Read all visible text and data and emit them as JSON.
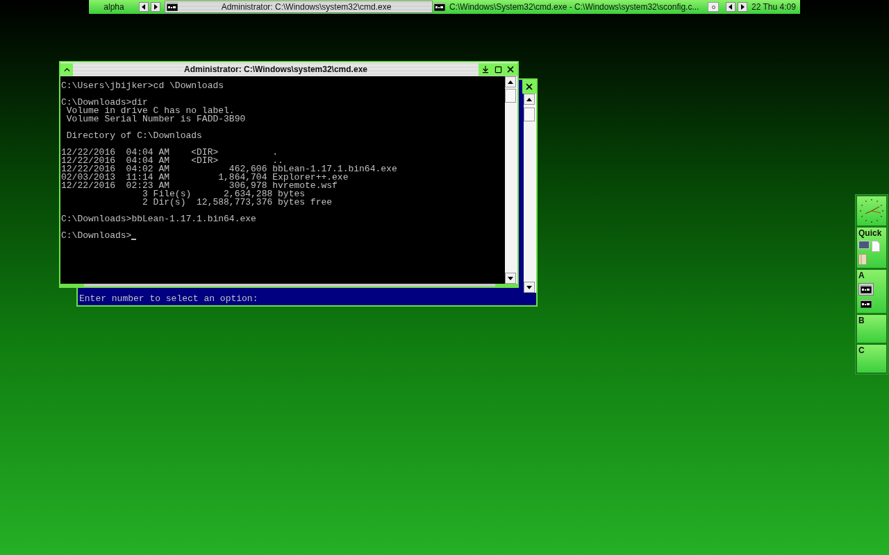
{
  "taskbar": {
    "workspace": "alpha",
    "tasks": [
      {
        "title": "Administrator: C:\\Windows\\system32\\cmd.exe",
        "selected": true
      },
      {
        "title": "C:\\Windows\\System32\\cmd.exe - C:\\Windows\\system32\\sconfig.c...",
        "selected": false
      }
    ],
    "clock": "22 Thu 4:09"
  },
  "back_window": {
    "prompt": "Enter number to select an option:"
  },
  "cmd_window": {
    "title": "Administrator: C:\\Windows\\system32\\cmd.exe",
    "blocks": [
      [
        "C:\\Users\\jbijker>cd \\Downloads"
      ],
      [
        "C:\\Downloads>dir",
        " Volume in drive C has no label.",
        " Volume Serial Number is FADD-3B90"
      ],
      [
        " Directory of C:\\Downloads"
      ],
      [
        "12/22/2016  04:04 AM    <DIR>          .",
        "12/22/2016  04:04 AM    <DIR>          ..",
        "12/22/2016  04:02 AM           462,606 bbLean-1.17.1.bin64.exe",
        "02/03/2013  11:14 AM         1,864,704 Explorer++.exe",
        "12/22/2016  02:23 AM           306,978 hvremote.wsf",
        "               3 File(s)      2,634,288 bytes",
        "               2 Dir(s)  12,588,773,376 bytes free"
      ],
      [
        "C:\\Downloads>bbLean-1.17.1.bin64.exe"
      ],
      [
        "C:\\Downloads>"
      ]
    ]
  },
  "slit": {
    "panels": [
      {
        "label": "Quick",
        "items": [
          {
            "kind": "window"
          },
          {
            "kind": "document"
          },
          {
            "kind": "cabinet"
          }
        ]
      },
      {
        "label": "A",
        "items": [
          {
            "kind": "console",
            "selected": true
          },
          {
            "kind": "console",
            "selected": false
          }
        ]
      },
      {
        "label": "B"
      },
      {
        "label": "C"
      }
    ]
  }
}
